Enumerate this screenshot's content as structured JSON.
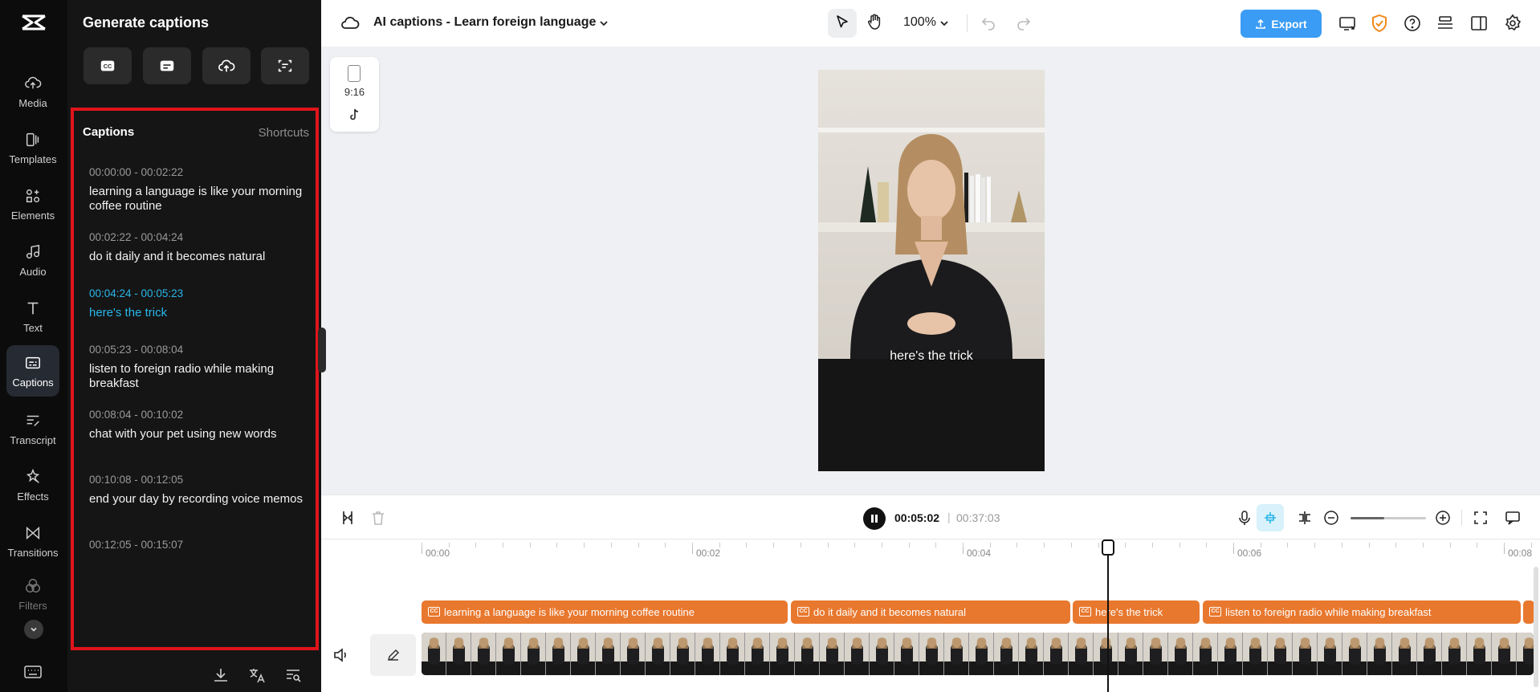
{
  "rail": {
    "items": [
      {
        "label": "Media",
        "icon": "cloud-upload-icon"
      },
      {
        "label": "Templates",
        "icon": "templates-icon"
      },
      {
        "label": "Elements",
        "icon": "elements-icon"
      },
      {
        "label": "Audio",
        "icon": "music-icon"
      },
      {
        "label": "Text",
        "icon": "text-icon"
      },
      {
        "label": "Captions",
        "icon": "captions-icon"
      },
      {
        "label": "Transcript",
        "icon": "transcript-icon"
      },
      {
        "label": "Effects",
        "icon": "effects-icon"
      },
      {
        "label": "Transitions",
        "icon": "transitions-icon"
      },
      {
        "label": "Filters",
        "icon": "filters-icon"
      }
    ],
    "active": "Captions"
  },
  "panel": {
    "title": "Generate captions",
    "captions_heading": "Captions",
    "shortcuts": "Shortcuts",
    "captions": [
      {
        "time": "00:00:00 - 00:02:22",
        "text": "learning a language is like your morning coffee routine",
        "active": false
      },
      {
        "time": "00:02:22 - 00:04:24",
        "text": "do it daily and it becomes natural",
        "active": false
      },
      {
        "time": "00:04:24 - 00:05:23",
        "text": "here's the trick",
        "active": true
      },
      {
        "time": "00:05:23 - 00:08:04",
        "text": "listen to foreign radio while making breakfast",
        "active": false
      },
      {
        "time": "00:08:04 - 00:10:02",
        "text": "chat with your pet using new words",
        "active": false
      },
      {
        "time": "00:10:08 - 00:12:05",
        "text": "end your day by recording voice memos",
        "active": false
      },
      {
        "time": "00:12:05 - 00:15:07",
        "text": "",
        "active": false
      }
    ]
  },
  "topbar": {
    "project_title": "AI captions - Learn foreign language",
    "zoom": "100%",
    "export_label": "Export"
  },
  "canvas": {
    "ratio": "9:16",
    "subtitle": "here's the trick"
  },
  "playback": {
    "current_time": "00:05:02",
    "separator": "|",
    "total_time": "00:37:03",
    "zoom_level": 0.45
  },
  "timeline": {
    "ruler": [
      "00:00",
      "00:02",
      "00:04",
      "00:06",
      "00:08"
    ],
    "caption_clips": [
      "learning a language is like your morning coffee routine",
      "do it daily and it becomes natural",
      "here's the trick",
      "listen to foreign radio while making breakfast"
    ]
  },
  "colors": {
    "accent": "#29b6ea",
    "export": "#3a9cf4",
    "caption_clip": "#e8782e",
    "highlight_border": "#e0141b"
  }
}
